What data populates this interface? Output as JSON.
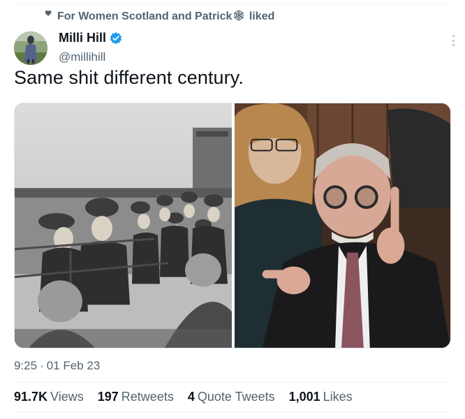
{
  "social_context": {
    "text_before": "For Women Scotland and Patrick",
    "text_after": "liked",
    "emoji_icon": "spider-web-icon"
  },
  "author": {
    "display_name": "Milli Hill",
    "handle": "@millihill",
    "verified": true,
    "verified_color": "#1d9bf0"
  },
  "tweet": {
    "text": "Same shit different century."
  },
  "media": {
    "left_photo": "historical-courtroom-photo",
    "right_photo": "modern-committee-photo"
  },
  "meta": {
    "time": "9:25",
    "separator": "·",
    "date": "01 Feb 23"
  },
  "stats": {
    "views": {
      "count": "91.7K",
      "label": "Views"
    },
    "retweets": {
      "count": "197",
      "label": "Retweets"
    },
    "quotes": {
      "count": "4",
      "label": "Quote Tweets"
    },
    "likes": {
      "count": "1,001",
      "label": "Likes"
    }
  },
  "colors": {
    "text_primary": "#0f1419",
    "text_secondary": "#536471",
    "divider": "#eff3f4"
  }
}
